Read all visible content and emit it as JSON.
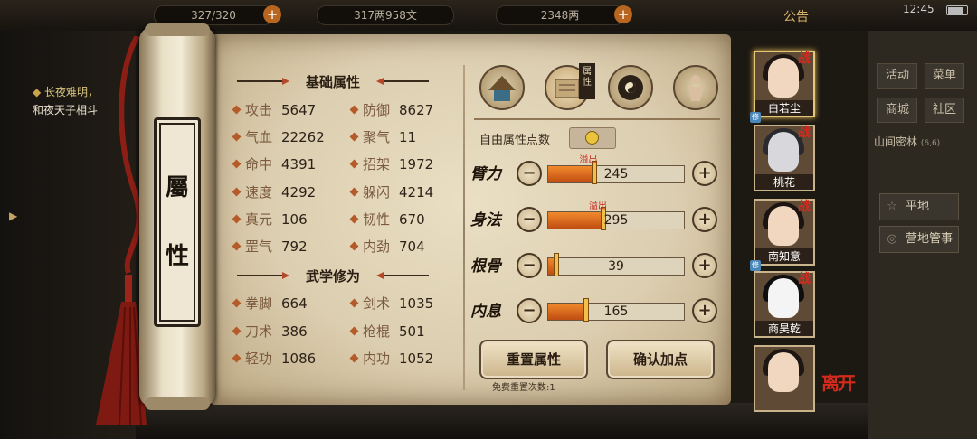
{
  "topbar": {
    "res1": "327/320",
    "money": "317两958文",
    "gold": "2348两",
    "notice": "公告",
    "clock": "12:45"
  },
  "quest": {
    "title": "长夜难明，",
    "sub": "和夜天子相斗"
  },
  "right_menu": {
    "huodong": "活动",
    "caidan": "菜单",
    "shangcheng": "商城",
    "shequ": "社区",
    "area_name": "山间密林",
    "area_level": "(6,6)",
    "pingdi": "平地",
    "yingdi": "营地管事"
  },
  "scroll": {
    "char1": "屬",
    "char2": "性"
  },
  "basic": {
    "title": "基础属性",
    "stats": [
      {
        "label": "攻击",
        "value": "5647"
      },
      {
        "label": "防御",
        "value": "8627"
      },
      {
        "label": "气血",
        "value": "22262"
      },
      {
        "label": "聚气",
        "value": "11"
      },
      {
        "label": "命中",
        "value": "4391"
      },
      {
        "label": "招架",
        "value": "1972"
      },
      {
        "label": "速度",
        "value": "4292"
      },
      {
        "label": "躲闪",
        "value": "4214"
      },
      {
        "label": "真元",
        "value": "106"
      },
      {
        "label": "韧性",
        "value": "670"
      },
      {
        "label": "罡气",
        "value": "792"
      },
      {
        "label": "内劲",
        "value": "704"
      }
    ]
  },
  "martial": {
    "title": "武学修为",
    "stats": [
      {
        "label": "拳脚",
        "value": "664"
      },
      {
        "label": "剑术",
        "value": "1035"
      },
      {
        "label": "刀术",
        "value": "386"
      },
      {
        "label": "枪棍",
        "value": "501"
      },
      {
        "label": "轻功",
        "value": "1086"
      },
      {
        "label": "内功",
        "value": "1052"
      }
    ]
  },
  "tabs": {
    "attr_label": "属性"
  },
  "points": {
    "free_label": "自由属性点数",
    "overflow": "溢出",
    "attrs": [
      {
        "name": "臂力",
        "value": "245",
        "fill": 0.33,
        "overflow": true
      },
      {
        "name": "身法",
        "value": "295",
        "fill": 0.4,
        "overflow": true
      },
      {
        "name": "根骨",
        "value": "39",
        "fill": 0.05,
        "overflow": false
      },
      {
        "name": "内息",
        "value": "165",
        "fill": 0.27,
        "overflow": false
      }
    ],
    "minus": "−",
    "plus": "+"
  },
  "buttons": {
    "reset": "重置属性",
    "confirm": "确认加点",
    "free_reset": "免费重置次数:1"
  },
  "roster": {
    "zhan": "战",
    "xiu": "修",
    "names": [
      "白若尘",
      "桃花",
      "南知意",
      "商昊乾"
    ],
    "leave": "离开"
  },
  "colors": {
    "accent": "#c04d12",
    "overflow": "#c6211b",
    "paper": "#e3d6b9"
  }
}
